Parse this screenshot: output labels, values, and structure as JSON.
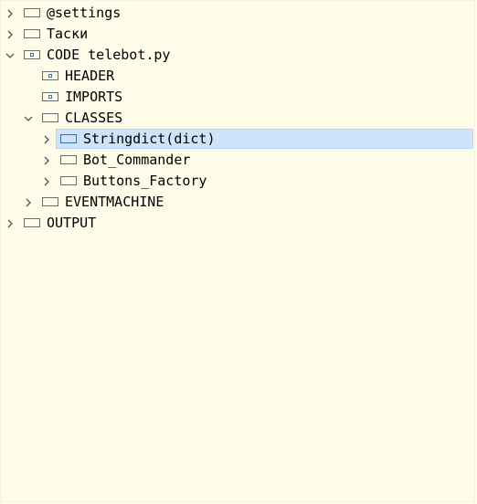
{
  "tree": {
    "items": [
      {
        "label": "@settings",
        "icon": "note-icon",
        "expander": "collapsed"
      },
      {
        "label": "Таски",
        "icon": "note-icon",
        "expander": "collapsed"
      },
      {
        "label": "CODE telebot.py",
        "icon": "file-node-icon",
        "expander": "expanded"
      },
      {
        "label": "HEADER",
        "icon": "file-node-icon",
        "expander": "none"
      },
      {
        "label": "IMPORTS",
        "icon": "file-node-icon",
        "expander": "none"
      },
      {
        "label": "CLASSES",
        "icon": "note-icon",
        "expander": "expanded"
      },
      {
        "label": "Stringdict(dict)",
        "icon": "note-icon",
        "expander": "collapsed",
        "selected": true
      },
      {
        "label": "Bot_Commander",
        "icon": "note-icon",
        "expander": "collapsed"
      },
      {
        "label": "Buttons_Factory",
        "icon": "note-icon",
        "expander": "collapsed"
      },
      {
        "label": "EVENTMACHINE",
        "icon": "note-icon",
        "expander": "collapsed"
      },
      {
        "label": "OUTPUT",
        "icon": "note-icon",
        "expander": "collapsed"
      }
    ]
  },
  "colors": {
    "background": "#fdfdea",
    "selection": "#cfe4fb"
  }
}
